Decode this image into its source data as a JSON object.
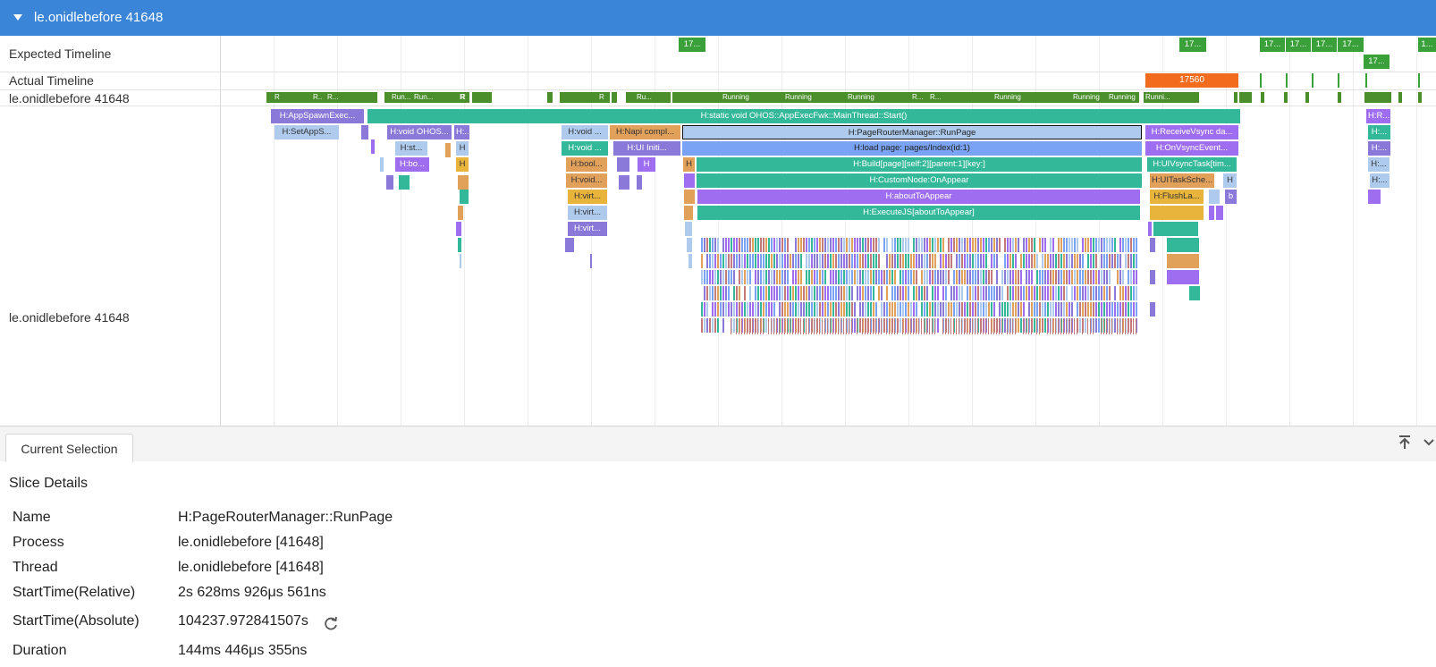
{
  "header": {
    "title": "le.onidlebefore 41648"
  },
  "tracks": {
    "expected": {
      "label": "Expected Timeline",
      "pills": [
        "17...",
        "17...",
        "17...",
        "17...",
        "17...",
        "17...",
        "17...",
        "1..."
      ]
    },
    "actual": {
      "label": "Actual Timeline",
      "frame_label": "17560"
    },
    "thread": {
      "label": "le.onidlebefore 41648"
    },
    "slices_label": "le.onidlebefore 41648",
    "state_labels": [
      "R",
      "R..",
      "R...",
      "R",
      "Run...",
      "Run...",
      "R",
      "R",
      "Ru...",
      "Running",
      "Running",
      "Running",
      "R...",
      "R...",
      "Running",
      "Running",
      "Running",
      "Runni...",
      "R",
      "R"
    ],
    "colors": {
      "green": "#3aa03a",
      "orange": "#f36b1c",
      "teal": "#34b89a",
      "purple": "#9f6ef0",
      "lavender": "#8a79d8",
      "lightblue": "#aecbee",
      "blue": "#7aa3f5",
      "tan": "#e2a15b",
      "gold": "#e8b43c"
    }
  },
  "slices": {
    "s0": "H:AppSpawnExec...",
    "s1": "H:static void OHOS::AppExecFwk::MainThread::Start()",
    "s2": "H:SetAppS...",
    "s3": "H:void OHOS...",
    "s4": "H:...",
    "s5": "H:void ...",
    "s6": "H:Napi compl...",
    "s7": "H:PageRouterManager::RunPage",
    "s8": "H:ReceiveVsync da...",
    "s9": "H:st...",
    "s10": "H",
    "s11": "H:void ...",
    "s12": "H:UI Initi...",
    "s13": "H:load page: pages/Index(id:1)",
    "s14": "H:OnVsyncEvent...",
    "s15": "H:bo...",
    "s16": "H",
    "s17": "H:bool...",
    "s18": "H",
    "s19": "H",
    "s20": "H:Build[page][self:2][parent:1][key:]",
    "s21": "H:UIVsyncTask[tim...",
    "s22": "H:void...",
    "s23": "H:CustomNode:OnAppear",
    "s24": "H:UITaskSche...",
    "s25": "H",
    "s26": "H:virt...",
    "s27": "H:aboutToAppear",
    "s28": "H:FlushLa...",
    "s29": "b",
    "s30": "H:virt...",
    "s31": "H:ExecuteJS[aboutToAppear]",
    "s32": "H:virt...",
    "s33": "H:R...",
    "s34": "H:...",
    "s35": "H:...",
    "s36": "H:...",
    "s37": "H:..."
  },
  "panel": {
    "tab_label": "Current Selection",
    "pin_icon": "pin-top-icon",
    "collapse_icon": "chevron-down-icon",
    "title": "Slice Details",
    "rows": [
      {
        "key": "Name",
        "value": "H:PageRouterManager::RunPage"
      },
      {
        "key": "Process",
        "value": "le.onidlebefore [41648]"
      },
      {
        "key": "Thread",
        "value": "le.onidlebefore [41648]"
      },
      {
        "key": "StartTime(Relative)",
        "value": "2s 628ms 926μs 561ns"
      },
      {
        "key": "StartTime(Absolute)",
        "value": "104237.972841507s"
      },
      {
        "key": "Duration",
        "value": "144ms 446μs 355ns"
      }
    ]
  }
}
